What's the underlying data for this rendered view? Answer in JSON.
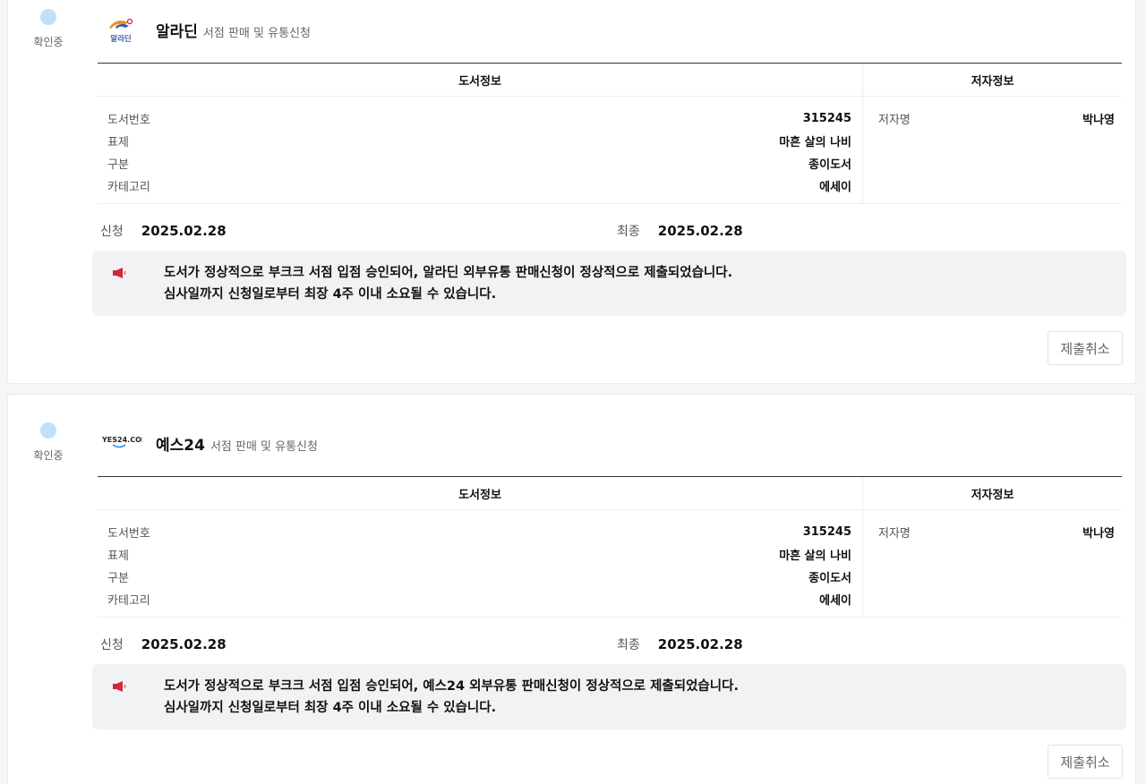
{
  "submissions": [
    {
      "status": "확인중",
      "store_name": "알라딘",
      "store_sub": "서점 판매 및 유통신청",
      "logo_text": "알라딘",
      "headers": {
        "book": "도서정보",
        "author": "저자정보"
      },
      "book": [
        {
          "label": "도서번호",
          "value": "315245"
        },
        {
          "label": "표제",
          "value": "마흔 살의 나비"
        },
        {
          "label": "구분",
          "value": "종이도서"
        },
        {
          "label": "카테고리",
          "value": "에세이"
        }
      ],
      "author": {
        "label": "저자명",
        "value": "박나영"
      },
      "applied": {
        "label": "신청",
        "value": "2025.02.28"
      },
      "final": {
        "label": "최종",
        "value": "2025.02.28"
      },
      "notice": [
        "도서가 정상적으로 부크크 서점 입점 승인되어, 알라딘 외부유통 판매신청이 정상적으로 제출되었습니다.",
        "심사일까지 신청일로부터 최장 4주 이내 소요될 수 있습니다."
      ],
      "cancel_label": "제출취소"
    },
    {
      "status": "확인중",
      "store_name": "예스24",
      "store_sub": "서점 판매 및 유통신청",
      "logo_text": "YES24.COM",
      "headers": {
        "book": "도서정보",
        "author": "저자정보"
      },
      "book": [
        {
          "label": "도서번호",
          "value": "315245"
        },
        {
          "label": "표제",
          "value": "마흔 살의 나비"
        },
        {
          "label": "구분",
          "value": "종이도서"
        },
        {
          "label": "카테고리",
          "value": "에세이"
        }
      ],
      "author": {
        "label": "저자명",
        "value": "박나영"
      },
      "applied": {
        "label": "신청",
        "value": "2025.02.28"
      },
      "final": {
        "label": "최종",
        "value": "2025.02.28"
      },
      "notice": [
        "도서가 정상적으로 부크크 서점 입점 승인되어, 예스24 외부유통 판매신청이 정상적으로 제출되었습니다.",
        "심사일까지 신청일로부터 최장 4주 이내 소요될 수 있습니다."
      ],
      "cancel_label": "제출취소"
    }
  ],
  "colors": {
    "status_dot": "#bfe0fa",
    "notice_bg": "#f1f2f4",
    "megaphone": "#d0283c"
  }
}
